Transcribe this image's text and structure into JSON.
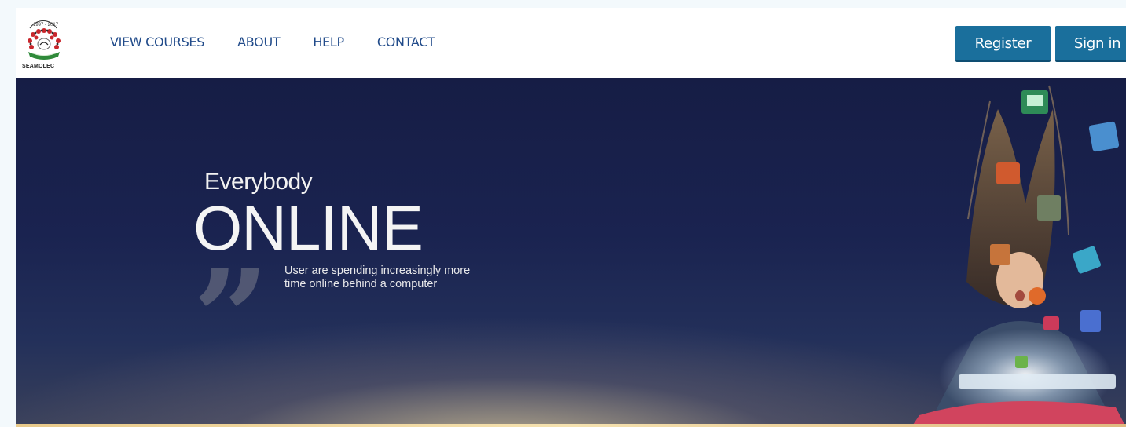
{
  "header": {
    "logo_text": "SEAMOLEC",
    "logo_years": "1997 - 2017",
    "nav": [
      {
        "label": "VIEW COURSES"
      },
      {
        "label": "ABOUT"
      },
      {
        "label": "HELP"
      },
      {
        "label": "CONTACT"
      }
    ],
    "register_label": "Register",
    "signin_label": "Sign in"
  },
  "hero": {
    "pre_title": "Everybody",
    "title": "ONLINE",
    "quote_mark": "”",
    "quote": "User are spending increasingly more time online behind a computer"
  },
  "colors": {
    "nav_text": "#214b8a",
    "button_bg": "#1a6f9c",
    "hero_bg": "#1a2350"
  }
}
